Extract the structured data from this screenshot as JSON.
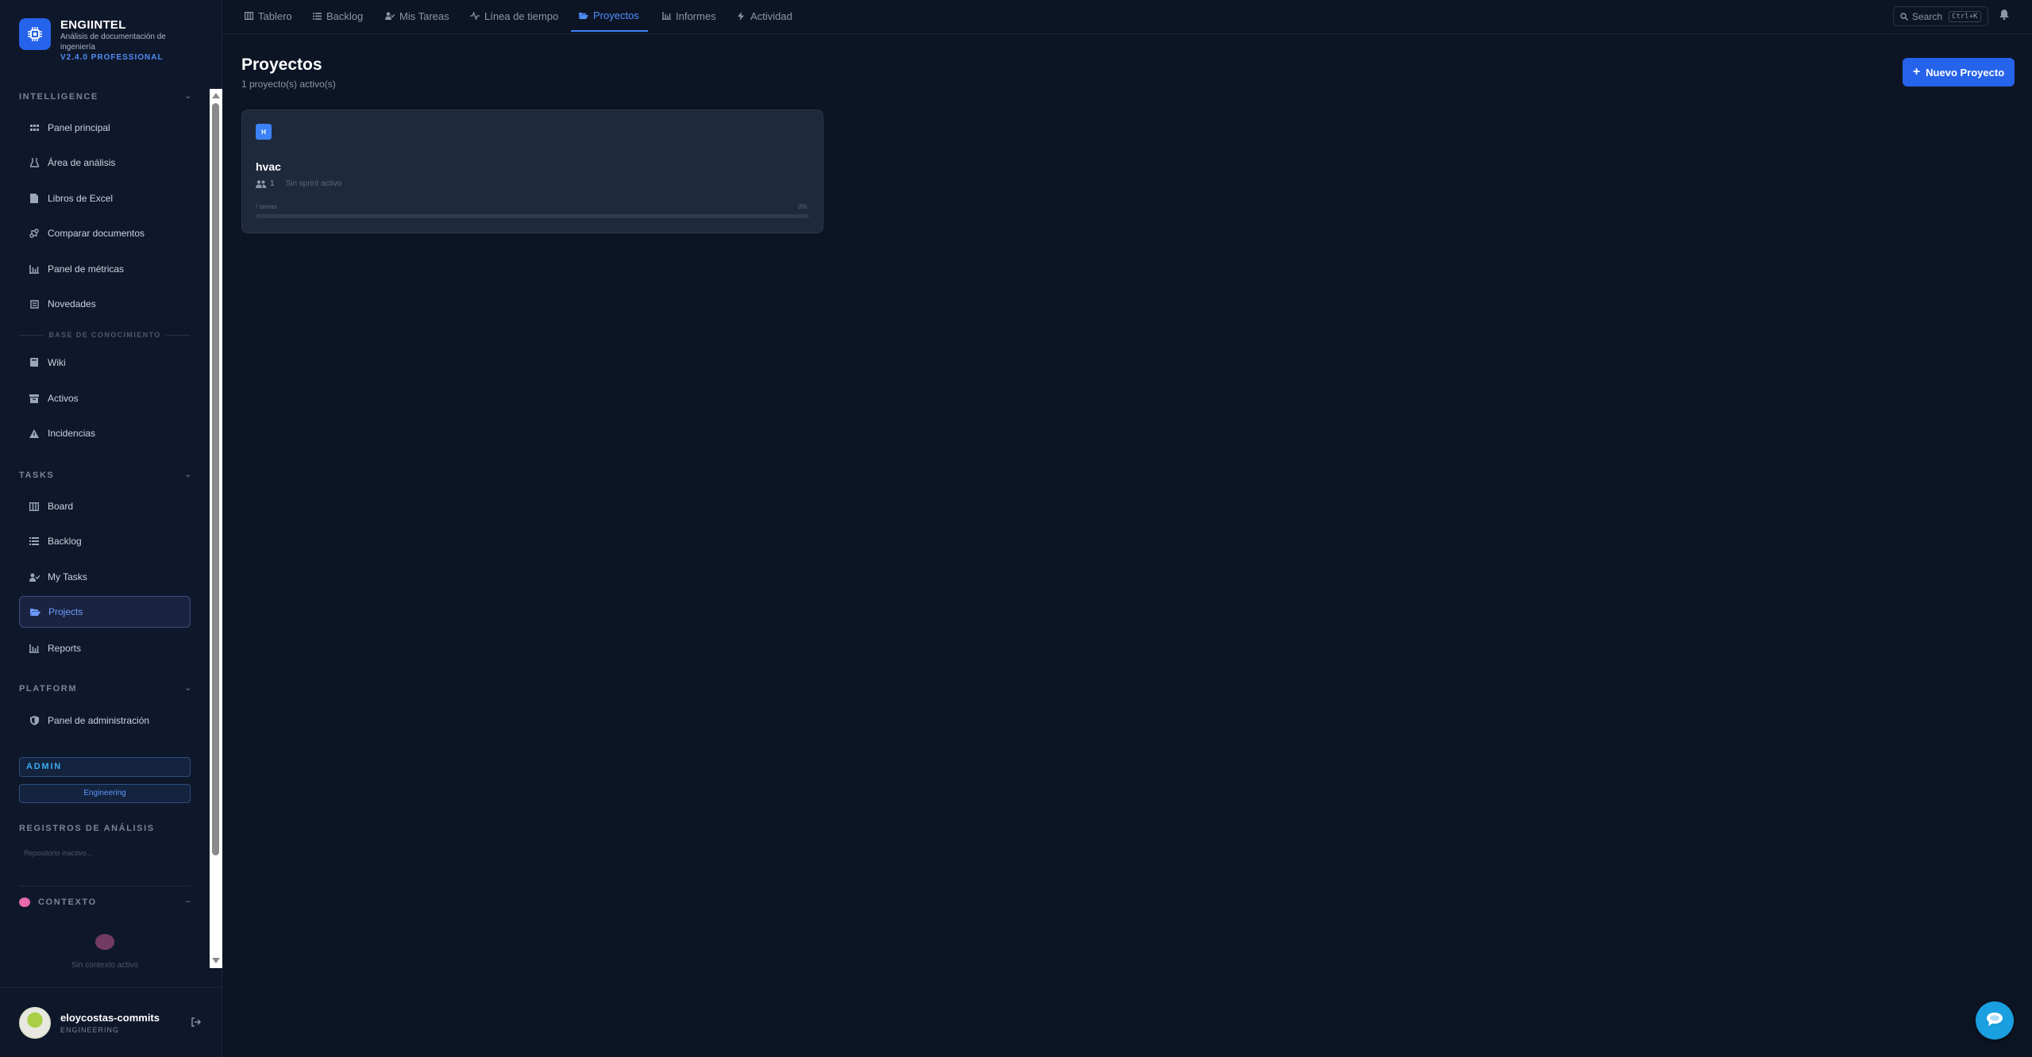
{
  "brand": {
    "title": "ENGIINTEL",
    "subtitle": "Análisis de documentación de ingeniería",
    "version": "V2.4.0 PROFESSIONAL"
  },
  "sidebar": {
    "intelligence": {
      "header": "INTELLIGENCE",
      "items": [
        {
          "label": "Panel principal",
          "icon": "grid-icon"
        },
        {
          "label": "Área de análisis",
          "icon": "flask-icon"
        },
        {
          "label": "Libros de Excel",
          "icon": "file-icon"
        },
        {
          "label": "Comparar documentos",
          "icon": "compare-icon"
        },
        {
          "label": "Panel de métricas",
          "icon": "bar-chart-icon"
        },
        {
          "label": "Novedades",
          "icon": "newspaper-icon"
        }
      ]
    },
    "knowledge": {
      "header": "BASE DE CONOCIMIENTO",
      "items": [
        {
          "label": "Wiki",
          "icon": "book-icon"
        },
        {
          "label": "Activos",
          "icon": "archive-icon"
        },
        {
          "label": "Incidencias",
          "icon": "warning-icon"
        }
      ]
    },
    "tasks": {
      "header": "TASKS",
      "items": [
        {
          "label": "Board",
          "icon": "board-icon"
        },
        {
          "label": "Backlog",
          "icon": "list-icon"
        },
        {
          "label": "My Tasks",
          "icon": "user-check-icon"
        },
        {
          "label": "Projects",
          "icon": "folder-open-icon"
        },
        {
          "label": "Reports",
          "icon": "bar-chart-icon"
        }
      ]
    },
    "platform": {
      "header": "PLATFORM",
      "items": [
        {
          "label": "Panel de administración",
          "icon": "shield-icon"
        }
      ]
    },
    "admin_badge": "ADMIN",
    "engineering_badge": "Engineering",
    "registros_header": "REGISTROS DE ANÁLISIS",
    "registros_sub": "Repositorio inactivo...",
    "context_header": "CONTEXTO",
    "context_toggle": "–",
    "context_empty": "Sin contexto activo"
  },
  "user": {
    "name": "eloycostas-commits",
    "role": "ENGINEERING"
  },
  "topbar": {
    "tabs": [
      {
        "label": "Tablero",
        "icon": "board-icon"
      },
      {
        "label": "Backlog",
        "icon": "list-icon"
      },
      {
        "label": "Mis Tareas",
        "icon": "user-check-icon"
      },
      {
        "label": "Línea de tiempo",
        "icon": "timeline-icon"
      },
      {
        "label": "Proyectos",
        "icon": "folder-open-icon"
      },
      {
        "label": "Informes",
        "icon": "bar-chart-icon"
      },
      {
        "label": "Actividad",
        "icon": "bolt-icon"
      }
    ],
    "active_tab": "Proyectos",
    "search_label": "Search",
    "search_shortcut": "Ctrl+K"
  },
  "main": {
    "title": "Proyectos",
    "subtitle": "1 proyecto(s) activo(s)",
    "new_button": "Nuevo Proyecto",
    "projects": [
      {
        "initial": "H",
        "name": "hvac",
        "members": "1",
        "sprint": "Sin sprint activo",
        "tasks": "/ tareas",
        "percent_label": "0%",
        "progress": 0
      }
    ]
  },
  "colors": {
    "background": "#0d1525",
    "sidebar": "#0f182a",
    "accent": "#2563eb",
    "active_text": "#4f8ef7",
    "card": "#1e293b"
  }
}
